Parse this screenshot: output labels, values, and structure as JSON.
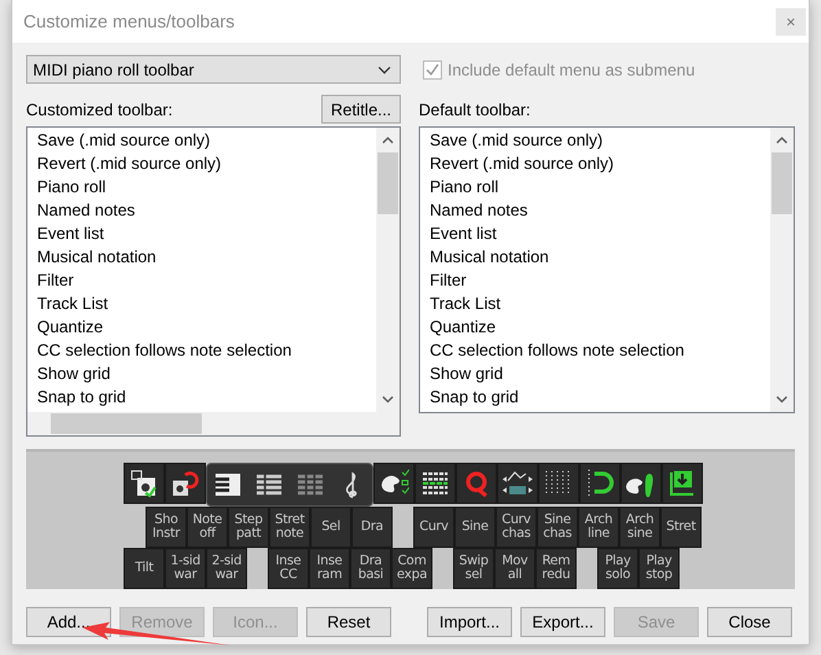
{
  "window": {
    "title": "Customize menus/toolbars",
    "close": "×"
  },
  "toolbar_select": {
    "value": "MIDI piano roll toolbar"
  },
  "include_default": {
    "label": "Include default menu as submenu",
    "checked": true,
    "disabled": true
  },
  "retitle_button": "Retitle...",
  "customized": {
    "label": "Customized toolbar:",
    "items": [
      "Save (.mid source only)",
      "Revert (.mid source only)",
      "Piano roll",
      "Named notes",
      "Event list",
      "Musical notation",
      "Filter",
      "Track List",
      "Quantize",
      "CC selection follows note selection",
      "Show grid",
      "Snap to grid"
    ]
  },
  "default": {
    "label": "Default toolbar:",
    "items": [
      "Save (.mid source only)",
      "Revert (.mid source only)",
      "Piano roll",
      "Named notes",
      "Event list",
      "Musical notation",
      "Filter",
      "Track List",
      "Quantize",
      "CC selection follows note selection",
      "Show grid",
      "Snap to grid"
    ]
  },
  "preview_rows": [
    [
      {
        "label": "Sho Instr",
        "gap_before": false
      },
      {
        "label": "Note off",
        "gap_before": false
      },
      {
        "label": "Step patt",
        "gap_before": false
      },
      {
        "label": "Stret note",
        "gap_before": false
      },
      {
        "label": "Sel",
        "gap_before": false
      },
      {
        "label": "Dra",
        "gap_before": false
      },
      {
        "label": "Curv",
        "gap_before": true
      },
      {
        "label": "Sine",
        "gap_before": false
      },
      {
        "label": "Curv chas",
        "gap_before": false
      },
      {
        "label": "Sine chas",
        "gap_before": false
      },
      {
        "label": "Arch line",
        "gap_before": false
      },
      {
        "label": "Arch sine",
        "gap_before": false
      },
      {
        "label": "Stret",
        "gap_before": false
      }
    ],
    [
      {
        "label": "Tilt",
        "gap_before": false
      },
      {
        "label": "1-sid war",
        "gap_before": false
      },
      {
        "label": "2-sid war",
        "gap_before": false
      },
      {
        "label": "Inse CC",
        "gap_before": true
      },
      {
        "label": "Inse ram",
        "gap_before": false
      },
      {
        "label": "Dra basi",
        "gap_before": false
      },
      {
        "label": "Com expa",
        "gap_before": false
      },
      {
        "label": "Swip sel",
        "gap_before": true
      },
      {
        "label": "Mov all",
        "gap_before": false
      },
      {
        "label": "Rem redu",
        "gap_before": false
      },
      {
        "label": "Play solo",
        "gap_before": true
      },
      {
        "label": "Play stop",
        "gap_before": false
      }
    ]
  ],
  "buttons": [
    {
      "label": "Add...",
      "disabled": false,
      "gap_before": false
    },
    {
      "label": "Remove",
      "disabled": true,
      "gap_before": false
    },
    {
      "label": "Icon...",
      "disabled": true,
      "gap_before": false
    },
    {
      "label": "Reset",
      "disabled": false,
      "gap_before": false
    },
    {
      "label": "Import...",
      "disabled": false,
      "gap_before": true
    },
    {
      "label": "Export...",
      "disabled": false,
      "gap_before": false
    },
    {
      "label": "Save",
      "disabled": true,
      "gap_before": false
    },
    {
      "label": "Close",
      "disabled": false,
      "gap_before": false
    }
  ]
}
